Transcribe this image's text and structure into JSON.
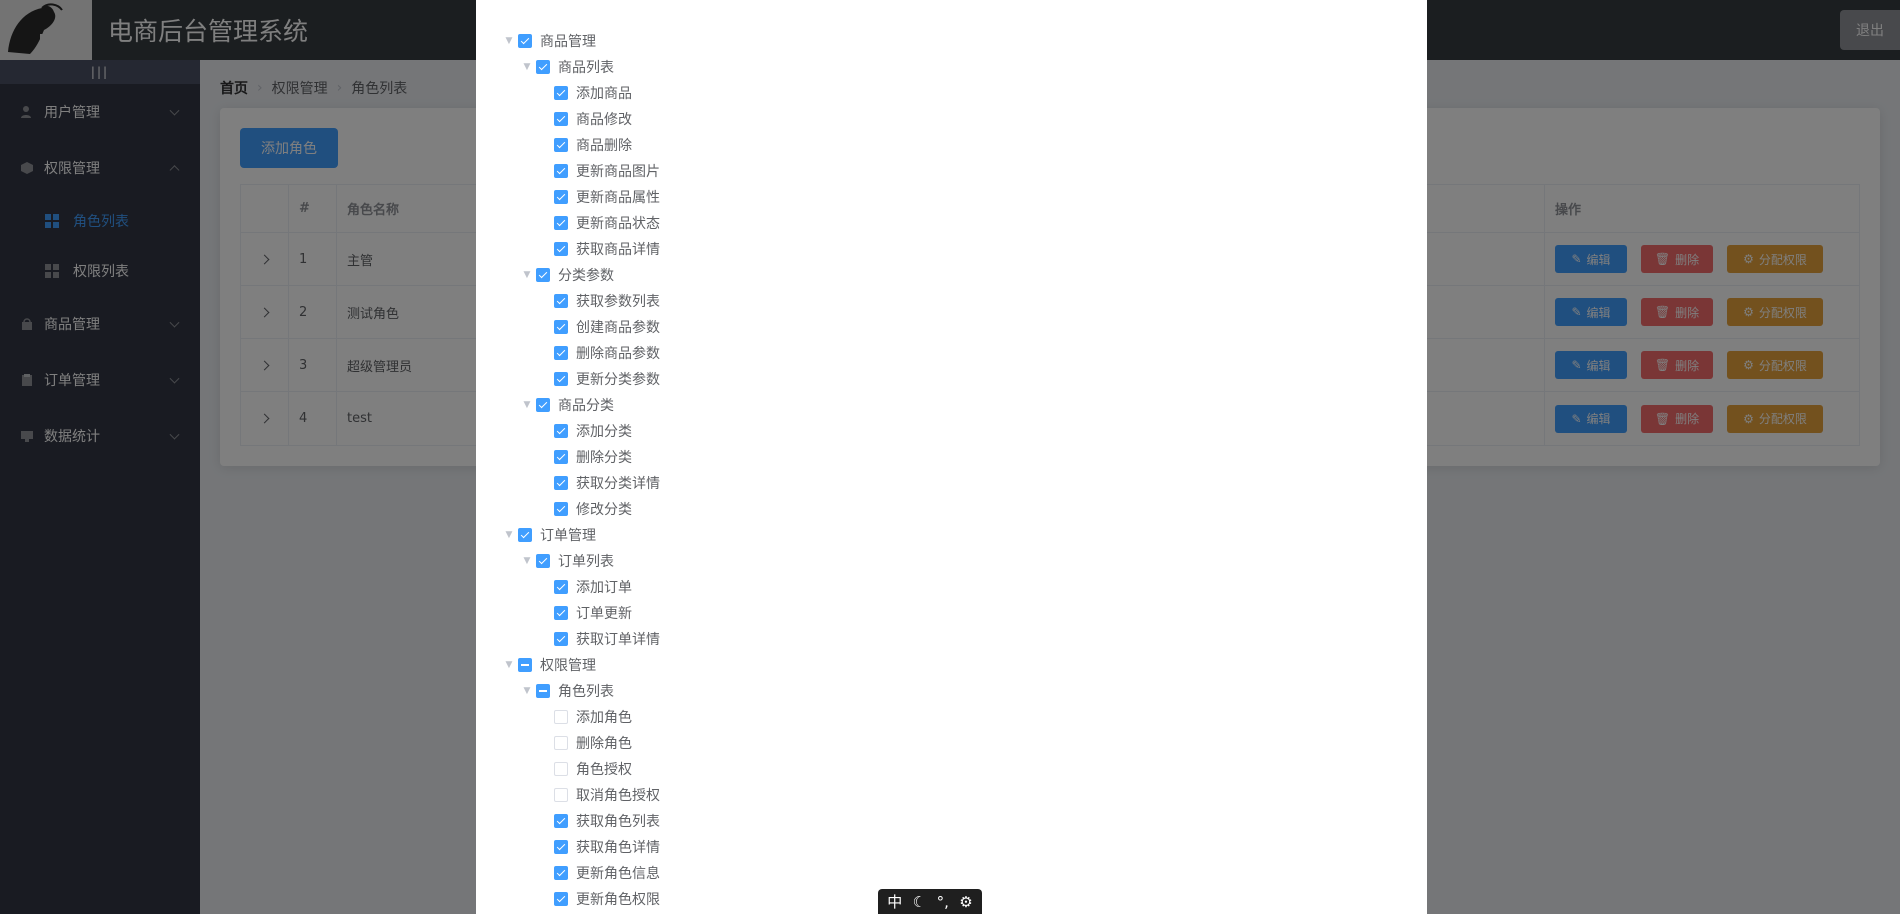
{
  "header": {
    "title": "电商后台管理系统",
    "logout_label": "退出"
  },
  "sidebar": {
    "toggle_label": "|||",
    "menus": [
      {
        "label": "用户管理",
        "icon": "user-icon"
      },
      {
        "label": "权限管理",
        "icon": "cube-icon",
        "expanded": true,
        "children": [
          {
            "label": "角色列表",
            "active": true
          },
          {
            "label": "权限列表",
            "active": false
          }
        ]
      },
      {
        "label": "商品管理",
        "icon": "shopping-bag-icon"
      },
      {
        "label": "订单管理",
        "icon": "clipboard-icon"
      },
      {
        "label": "数据统计",
        "icon": "monitor-icon"
      }
    ]
  },
  "breadcrumb": [
    "首页",
    "权限管理",
    "角色列表"
  ],
  "toolbar": {
    "add_role_label": "添加角色"
  },
  "table": {
    "headers": {
      "index": "#",
      "name": "角色名称",
      "ops": "操作"
    },
    "rows": [
      {
        "index": "1",
        "name": "主管"
      },
      {
        "index": "2",
        "name": "测试角色"
      },
      {
        "index": "3",
        "name": "超级管理员"
      },
      {
        "index": "4",
        "name": "test"
      }
    ],
    "edit_label": "编辑",
    "delete_label": "删除",
    "assign_label": "分配权限"
  },
  "tree": [
    {
      "level": 0,
      "label": "商品管理",
      "state": "checked"
    },
    {
      "level": 1,
      "label": "商品列表",
      "state": "checked"
    },
    {
      "level": 2,
      "label": "添加商品",
      "state": "checked"
    },
    {
      "level": 2,
      "label": "商品修改",
      "state": "checked"
    },
    {
      "level": 2,
      "label": "商品删除",
      "state": "checked"
    },
    {
      "level": 2,
      "label": "更新商品图片",
      "state": "checked"
    },
    {
      "level": 2,
      "label": "更新商品属性",
      "state": "checked"
    },
    {
      "level": 2,
      "label": "更新商品状态",
      "state": "checked"
    },
    {
      "level": 2,
      "label": "获取商品详情",
      "state": "checked"
    },
    {
      "level": 1,
      "label": "分类参数",
      "state": "checked"
    },
    {
      "level": 2,
      "label": "获取参数列表",
      "state": "checked"
    },
    {
      "level": 2,
      "label": "创建商品参数",
      "state": "checked"
    },
    {
      "level": 2,
      "label": "删除商品参数",
      "state": "checked"
    },
    {
      "level": 2,
      "label": "更新分类参数",
      "state": "checked"
    },
    {
      "level": 1,
      "label": "商品分类",
      "state": "checked"
    },
    {
      "level": 2,
      "label": "添加分类",
      "state": "checked"
    },
    {
      "level": 2,
      "label": "删除分类",
      "state": "checked"
    },
    {
      "level": 2,
      "label": "获取分类详情",
      "state": "checked"
    },
    {
      "level": 2,
      "label": "修改分类",
      "state": "checked"
    },
    {
      "level": 0,
      "label": "订单管理",
      "state": "checked"
    },
    {
      "level": 1,
      "label": "订单列表",
      "state": "checked"
    },
    {
      "level": 2,
      "label": "添加订单",
      "state": "checked"
    },
    {
      "level": 2,
      "label": "订单更新",
      "state": "checked"
    },
    {
      "level": 2,
      "label": "获取订单详情",
      "state": "checked"
    },
    {
      "level": 0,
      "label": "权限管理",
      "state": "half"
    },
    {
      "level": 1,
      "label": "角色列表",
      "state": "half"
    },
    {
      "level": 2,
      "label": "添加角色",
      "state": "unchecked"
    },
    {
      "level": 2,
      "label": "删除角色",
      "state": "unchecked"
    },
    {
      "level": 2,
      "label": "角色授权",
      "state": "unchecked"
    },
    {
      "level": 2,
      "label": "取消角色授权",
      "state": "unchecked"
    },
    {
      "level": 2,
      "label": "获取角色列表",
      "state": "checked"
    },
    {
      "level": 2,
      "label": "获取角色详情",
      "state": "checked"
    },
    {
      "level": 2,
      "label": "更新角色信息",
      "state": "checked"
    },
    {
      "level": 2,
      "label": "更新角色权限",
      "state": "checked"
    }
  ],
  "ime": {
    "lang": "中",
    "mode": "☾",
    "punct": "°,",
    "settings": "⚙"
  }
}
